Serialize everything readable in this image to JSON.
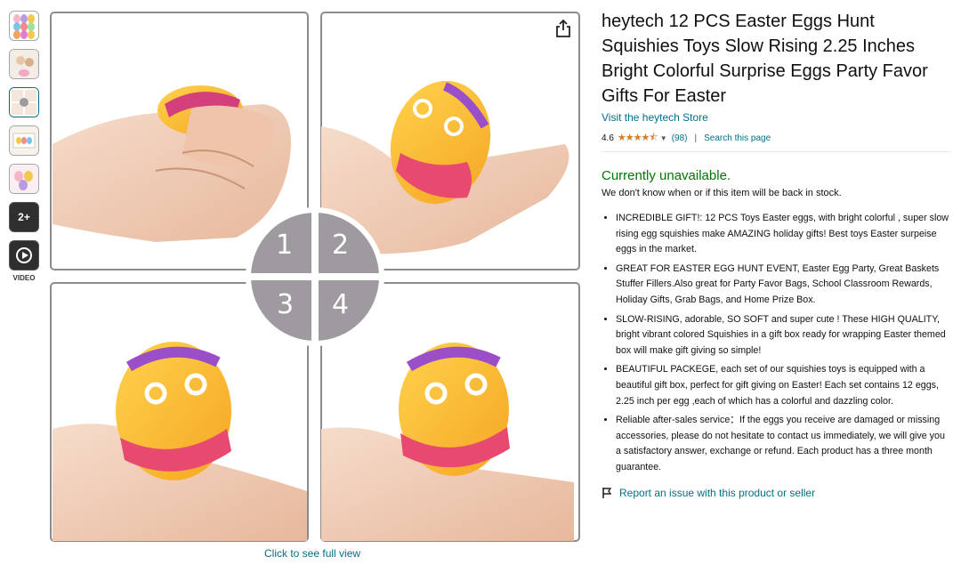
{
  "thumbnails": {
    "extra_count": "2+",
    "video_label": "VIDEO"
  },
  "gallery": {
    "quadrant_numbers": [
      "1",
      "2",
      "3",
      "4"
    ],
    "click_full_view": "Click to see full view"
  },
  "product": {
    "title": "heytech 12 PCS Easter Eggs Hunt Squishies Toys Slow Rising 2.25 Inches Bright Colorful Surprise Eggs Party Favor Gifts For Easter",
    "store_link": "Visit the heytech Store",
    "rating_value": "4.6",
    "stars_display": "★★★★⯪",
    "review_count": "(98)",
    "search_page": "Search this page",
    "availability": "Currently unavailable.",
    "availability_note": "We don't know when or if this item will be back in stock.",
    "bullets": [
      "INCREDIBLE GIFT!: 12 PCS Toys Easter eggs, with bright colorful , super slow rising egg squishies make AMAZING holiday gifts! Best toys Easter surpeise eggs in the market.",
      "GREAT FOR EASTER EGG HUNT EVENT, Easter Egg Party, Great Baskets Stuffer Fillers.Also great for Party Favor Bags, School Classroom Rewards, Holiday Gifts, Grab Bags, and Home Prize Box.",
      "SLOW-RISING, adorable, SO SOFT and super cute ! These HIGH QUALITY, bright vibrant colored Squishies in a gift box ready for wrapping Easter themed box will make gift giving so simple!",
      "BEAUTIFUL PACKEGE, each set of our squishies toys is equipped with a beautiful gift box, perfect for gift giving on Easter! Each set contains 12 eggs, 2.25 inch per egg ,each of which has a colorful and dazzling color.",
      "Reliable after-sales service：If the eggs you receive are damaged or missing accessories, please do not hesitate to contact us immediately, we will give you a satisfactory answer, exchange or refund. Each product has a three month guarantee."
    ],
    "report_link": "Report an issue with this product or seller"
  },
  "colors": {
    "link": "#007185",
    "available_green": "#007600",
    "star": "#de7921",
    "badge_gray": "#9e9aa0"
  }
}
